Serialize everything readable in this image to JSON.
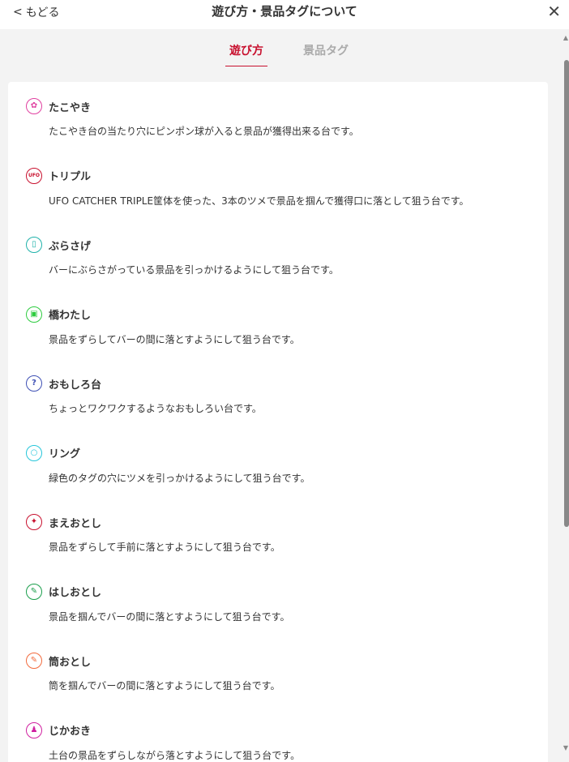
{
  "header": {
    "back_label": "もどる",
    "title": "遊び方・景品タグについて",
    "close_glyph": "✕"
  },
  "tabs": [
    {
      "label": "遊び方",
      "active": true
    },
    {
      "label": "景品タグ",
      "active": false
    }
  ],
  "items": [
    {
      "name": "たこやき",
      "desc": "たこやき台の当たり穴にピンポン球が入ると景品が獲得出来る台です。",
      "icon": "takoyaki-icon",
      "color": "#e040a0",
      "glyph": "✿"
    },
    {
      "name": "トリプル",
      "desc": "UFO CATCHER TRIPLE筐体を使った、3本のツメで景品を掴んで獲得口に落として狙う台です。",
      "icon": "ufo-triple-icon",
      "color": "#c8102e",
      "glyph": "UFO"
    },
    {
      "name": "ぶらさげ",
      "desc": "バーにぶらさがっている景品を引っかけるようにして狙う台です。",
      "icon": "hanging-icon",
      "color": "#20b2aa",
      "glyph": "▯"
    },
    {
      "name": "橋わたし",
      "desc": "景品をずらしてバーの間に落とすようにして狙う台です。",
      "icon": "bridge-icon",
      "color": "#2ecc40",
      "glyph": "▣"
    },
    {
      "name": "おもしろ台",
      "desc": "ちょっとワクワクするようなおもしろい台です。",
      "icon": "fun-icon",
      "color": "#3f51b5",
      "glyph": "?"
    },
    {
      "name": "リング",
      "desc": "緑色のタグの穴にツメを引っかけるようにして狙う台です。",
      "icon": "ring-icon",
      "color": "#26c6da",
      "glyph": "○"
    },
    {
      "name": "まえおとし",
      "desc": "景品をずらして手前に落とすようにして狙う台です。",
      "icon": "front-drop-icon",
      "color": "#c8102e",
      "glyph": "✦"
    },
    {
      "name": "はしおとし",
      "desc": "景品を掴んでバーの間に落とすようにして狙う台です。",
      "icon": "edge-drop-icon",
      "color": "#1a9e4b",
      "glyph": "✎"
    },
    {
      "name": "筒おとし",
      "desc": "筒を掴んでバーの間に落とすようにして狙う台です。",
      "icon": "tube-drop-icon",
      "color": "#f26a3d",
      "glyph": "✎"
    },
    {
      "name": "じかおき",
      "desc": "土台の景品をずらしながら落とすようにして狙う台です。",
      "icon": "direct-place-icon",
      "color": "#d020a0",
      "glyph": "♟"
    }
  ]
}
